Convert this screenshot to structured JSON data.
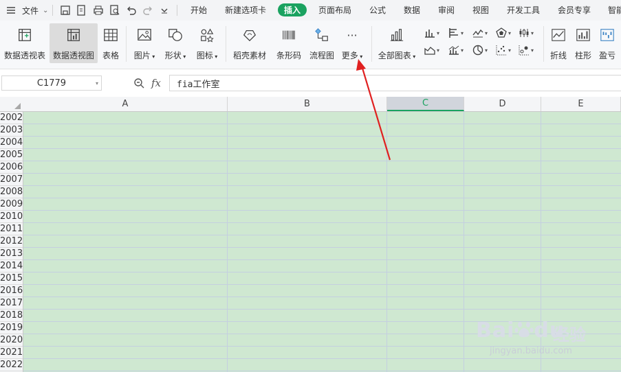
{
  "menubar": {
    "file_label": "文件",
    "tabs": [
      {
        "label": "开始",
        "active": false
      },
      {
        "label": "新建选项卡",
        "active": false
      },
      {
        "label": "插入",
        "active": true
      },
      {
        "label": "页面布局",
        "active": false
      },
      {
        "label": "公式",
        "active": false
      },
      {
        "label": "数据",
        "active": false
      },
      {
        "label": "审阅",
        "active": false
      },
      {
        "label": "视图",
        "active": false
      },
      {
        "label": "开发工具",
        "active": false
      },
      {
        "label": "会员专享",
        "active": false
      },
      {
        "label": "智能",
        "active": false
      }
    ]
  },
  "ribbon": {
    "pivot_table": "数据透视表",
    "pivot_chart": "数据透视图",
    "table": "表格",
    "picture": "图片",
    "shape": "形状",
    "icon": "图标",
    "docer_material": "稻壳素材",
    "barcode": "条形码",
    "flowchart": "流程图",
    "more": "更多",
    "all_charts": "全部图表",
    "sparkline_line": "折线",
    "sparkline_column": "柱形",
    "sparkline_winloss": "盈亏"
  },
  "formula_bar": {
    "name_box": "C1779",
    "fx_label": "fx",
    "content": "fia工作室"
  },
  "sheet": {
    "columns": [
      "A",
      "B",
      "C",
      "D",
      "E"
    ],
    "selected_column": "C",
    "rows": [
      "2002",
      "2003",
      "2004",
      "2005",
      "2006",
      "2007",
      "2008",
      "2009",
      "2010",
      "2011",
      "2012",
      "2013",
      "2014",
      "2015",
      "2016",
      "2017",
      "2018",
      "2019",
      "2020",
      "2021",
      "2022"
    ]
  },
  "colors": {
    "accent": "#1aa260",
    "cell_fill": "#cfe8d1",
    "annotation_arrow": "#e02020"
  },
  "watermark": {
    "brand": "Bai",
    "brand_du": "du",
    "brand_cn": "经验",
    "url": "jingyan.baidu.com"
  }
}
